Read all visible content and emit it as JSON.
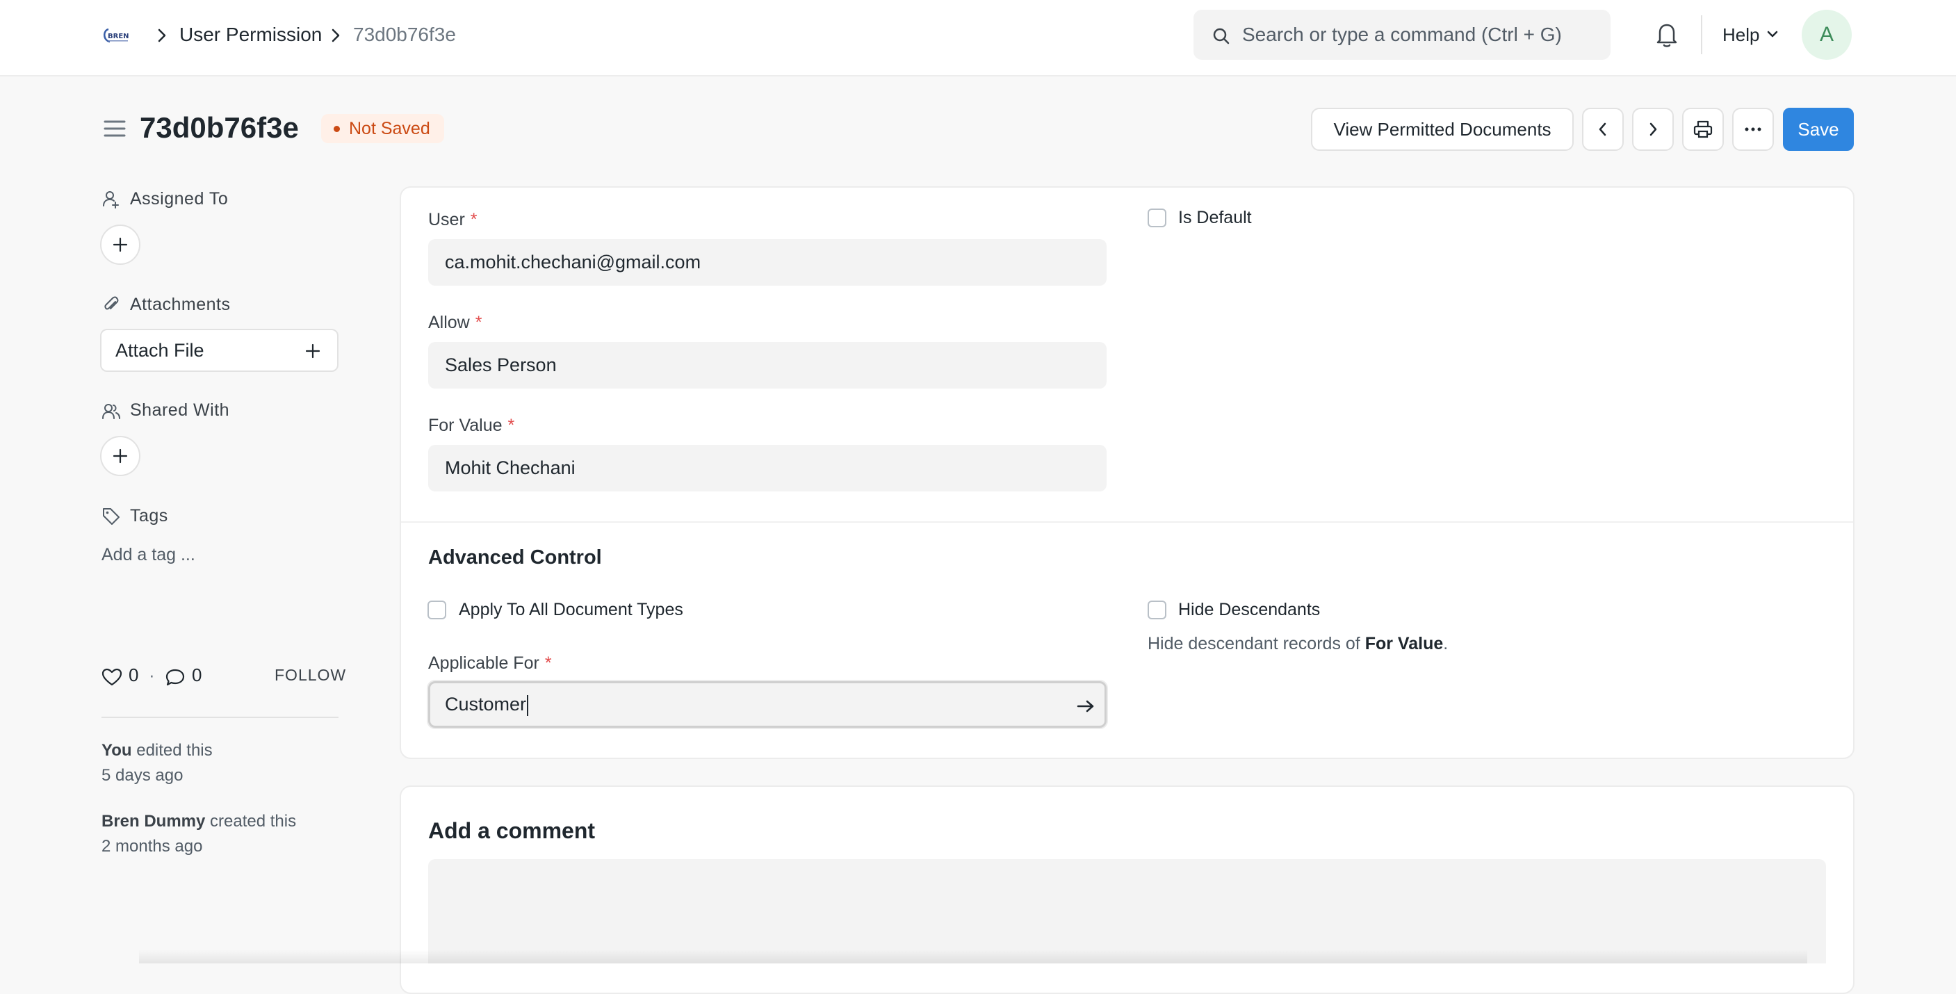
{
  "navbar": {
    "breadcrumbs": [
      "User Permission",
      "73d0b76f3e"
    ],
    "search_placeholder": "Search or type a command (Ctrl + G)",
    "help_label": "Help",
    "avatar_initial": "A"
  },
  "page": {
    "title": "73d0b76f3e",
    "status": "Not Saved",
    "status_color": "#cb4a13"
  },
  "actions": {
    "view_permitted_label": "View Permitted Documents",
    "save_label": "Save",
    "save_color": "#2f86e0"
  },
  "sidebar": {
    "assigned_to_label": "Assigned To",
    "attachments_label": "Attachments",
    "attach_file_label": "Attach File",
    "shared_with_label": "Shared With",
    "tags_label": "Tags",
    "add_tag_label": "Add a tag ...",
    "likes_count": "0",
    "separator": "·",
    "comments_count": "0",
    "follow_label": "FOLLOW",
    "activity": [
      {
        "actor": "You",
        "action": "edited this",
        "when": "5 days ago"
      },
      {
        "actor": "Bren Dummy",
        "action": "created this",
        "when": "2 months ago"
      }
    ]
  },
  "form": {
    "user_label": "User",
    "user_value": "ca.mohit.chechani@gmail.com",
    "allow_label": "Allow",
    "allow_value": "Sales Person",
    "for_value_label": "For Value",
    "for_value_value": "Mohit Chechani",
    "is_default_label": "Is Default",
    "required_mark": "*",
    "advanced_title": "Advanced Control",
    "apply_all_label": "Apply To All Document Types",
    "hide_descendants_label": "Hide Descendants",
    "hide_hint_prefix": "Hide descendant records of",
    "hide_hint_field": "For Value",
    "hide_hint_suffix": ".",
    "applicable_for_label": "Applicable For",
    "applicable_for_value": "Customer"
  },
  "comment": {
    "title": "Add a comment"
  }
}
